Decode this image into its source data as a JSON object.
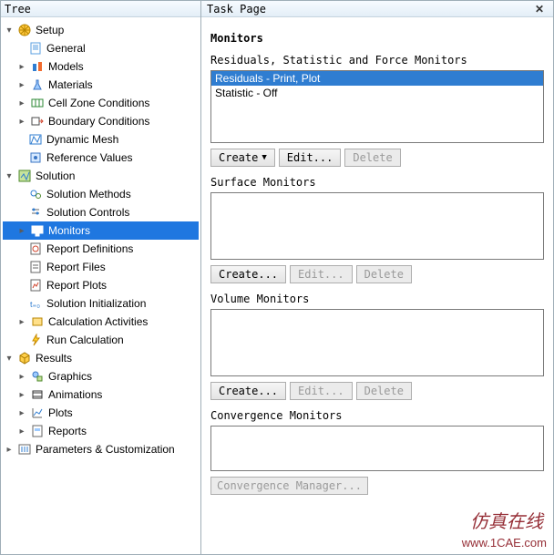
{
  "tree": {
    "header": "Tree",
    "nodes": {
      "setup": "Setup",
      "general": "General",
      "models": "Models",
      "materials": "Materials",
      "cell_zone": "Cell Zone Conditions",
      "boundary": "Boundary Conditions",
      "dynamic_mesh": "Dynamic Mesh",
      "reference_values": "Reference Values",
      "solution": "Solution",
      "solution_methods": "Solution Methods",
      "solution_controls": "Solution Controls",
      "monitors": "Monitors",
      "report_definitions": "Report Definitions",
      "report_files": "Report Files",
      "report_plots": "Report Plots",
      "solution_init": "Solution Initialization",
      "calc_activities": "Calculation Activities",
      "run_calc": "Run Calculation",
      "results": "Results",
      "graphics": "Graphics",
      "animations": "Animations",
      "plots": "Plots",
      "reports": "Reports",
      "params": "Parameters & Customization"
    }
  },
  "task": {
    "header": "Task Page",
    "title": "Monitors",
    "residuals_section": "Residuals, Statistic and Force Monitors",
    "residuals_items": {
      "i0": "Residuals - Print, Plot",
      "i1": "Statistic - Off"
    },
    "surface_section": "Surface Monitors",
    "volume_section": "Volume Monitors",
    "convergence_section": "Convergence Monitors",
    "buttons": {
      "create_drop": "Create",
      "create": "Create...",
      "edit": "Edit...",
      "delete": "Delete",
      "conv_manager": "Convergence Manager..."
    }
  },
  "watermark": {
    "line1": "仿真在线",
    "line2": "www.1CAE.com"
  }
}
